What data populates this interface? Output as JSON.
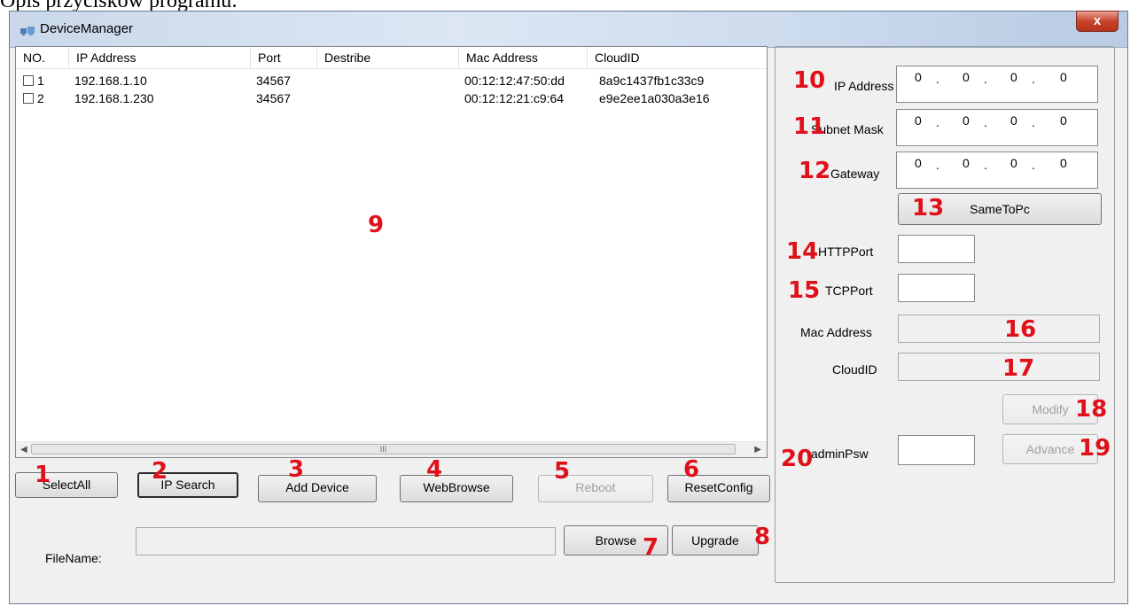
{
  "doc_caption": "Opis przycisków programu:",
  "window": {
    "title": "DeviceManager",
    "close_label": "x"
  },
  "list": {
    "columns": [
      "NO.",
      "IP Address",
      "Port",
      "Destribe",
      "Mac Address",
      "CloudID"
    ],
    "rows": [
      {
        "no": "1",
        "ip": "192.168.1.10",
        "port": "34567",
        "describe": "",
        "mac": "00:12:12:47:50:dd",
        "cloud": "8a9c1437fb1c33c9"
      },
      {
        "no": "2",
        "ip": "192.168.1.230",
        "port": "34567",
        "describe": "",
        "mac": "00:12:12:21:c9:64",
        "cloud": "e9e2ee1a030a3e16"
      }
    ],
    "scroll_thumb_label": "III"
  },
  "buttons": {
    "select_all": "SelectAll",
    "ip_search": "IP Search",
    "add_device": "Add Device",
    "web_browse": "WebBrowse",
    "reboot": "Reboot",
    "reset_config": "ResetConfig",
    "browse": "Browse",
    "upgrade": "Upgrade",
    "same_to_pc": "SameToPc",
    "modify": "Modify",
    "advance": "Advance"
  },
  "file": {
    "label": "FileName:",
    "value": ""
  },
  "settings": {
    "ip_label": "IP Address",
    "mask_label": "Subnet Mask",
    "gateway_label": "Gateway",
    "ip_octets": [
      "0",
      "0",
      "0",
      "0"
    ],
    "mask_octets": [
      "0",
      "0",
      "0",
      "0"
    ],
    "gateway_octets": [
      "0",
      "0",
      "0",
      "0"
    ],
    "http_label": "HTTPPort",
    "tcp_label": "TCPPort",
    "mac_label": "Mac Address",
    "cloud_label": "CloudID",
    "admin_label": "adminPsw",
    "http_value": "",
    "tcp_value": "",
    "mac_value": "",
    "cloud_value": "",
    "admin_value": ""
  },
  "markers": [
    "1",
    "2",
    "3",
    "4",
    "5",
    "6",
    "7",
    "8",
    "9",
    "10",
    "11",
    "12",
    "13",
    "14",
    "15",
    "16",
    "17",
    "18",
    "19",
    "20"
  ],
  "colors": {
    "marker": "#e0101a",
    "title_bar": "#c9d8ea",
    "close": "#c7432b"
  }
}
